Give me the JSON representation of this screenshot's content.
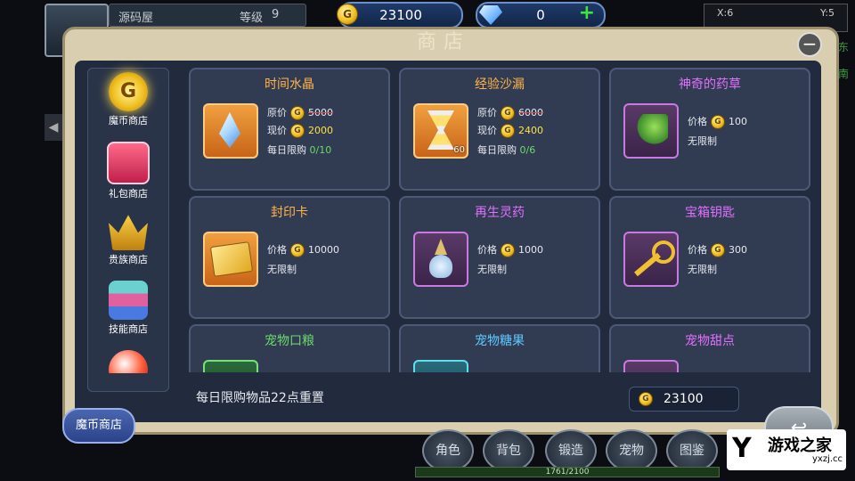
{
  "hud": {
    "player_name": "源码屋",
    "level_label": "等级",
    "level": "9",
    "gold": "23100",
    "diamonds": "0",
    "map_x": "X:6",
    "map_y": "Y:5"
  },
  "shop": {
    "title": "商店",
    "categories": [
      {
        "label": "魔币商店",
        "icon": "gold-coin-icon"
      },
      {
        "label": "礼包商店",
        "icon": "gift-box-icon"
      },
      {
        "label": "贵族商店",
        "icon": "crown-icon"
      },
      {
        "label": "技能商店",
        "icon": "books-icon"
      },
      {
        "label": "",
        "icon": "orb-icon"
      }
    ],
    "items": [
      {
        "name": "时间水晶",
        "orig_label": "原价",
        "orig_price": "5000",
        "now_label": "现价",
        "now_price": "2000",
        "limit_label": "每日限购",
        "limit_value": "0/10"
      },
      {
        "name": "经验沙漏",
        "orig_label": "原价",
        "orig_price": "6000",
        "now_label": "现价",
        "now_price": "2400",
        "limit_label": "每日限购",
        "limit_value": "0/6",
        "count": "60"
      },
      {
        "name": "神奇的药草",
        "price_label": "价格",
        "price": "100",
        "limit_text": "无限制"
      },
      {
        "name": "封印卡",
        "price_label": "价格",
        "price": "10000",
        "limit_text": "无限制"
      },
      {
        "name": "再生灵药",
        "price_label": "价格",
        "price": "1000",
        "limit_text": "无限制"
      },
      {
        "name": "宝箱钥匙",
        "price_label": "价格",
        "price": "300",
        "limit_text": "无限制"
      },
      {
        "name": "宠物口粮"
      },
      {
        "name": "宠物糖果"
      },
      {
        "name": "宠物甜点"
      }
    ],
    "reset_notice": "每日限购物品22点重置",
    "balance": "23100",
    "active_tab": "魔币商店"
  },
  "bottom_nav": [
    "角色",
    "背包",
    "锻造",
    "宠物",
    "图鉴"
  ],
  "exp_text": "1761/2100",
  "right_hint": [
    "东",
    "南"
  ],
  "watermark": {
    "name": "游戏之家",
    "url": "yxzj.cc"
  },
  "colors": {
    "panel": "#d9cfb0",
    "inner": "#222b3e",
    "card": "#313c52",
    "gold": "#f0c020"
  }
}
